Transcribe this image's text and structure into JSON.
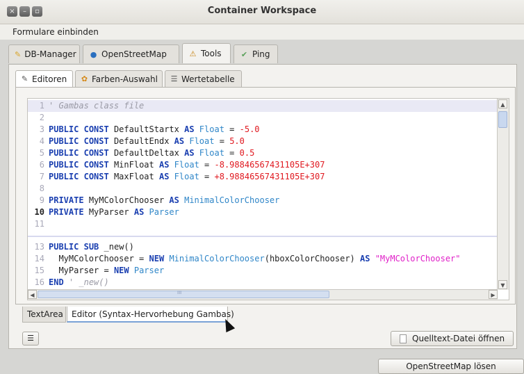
{
  "window": {
    "title": "Container Workspace",
    "controls": {
      "close": "×",
      "minimize": "–",
      "maximize": "▫"
    }
  },
  "menu": {
    "item": "Formulare einbinden"
  },
  "outer_tabs": [
    {
      "label": "DB-Manager",
      "icon": "wand-icon"
    },
    {
      "label": "OpenStreetMap",
      "icon": "globe-icon"
    },
    {
      "label": "Tools",
      "icon": "compass-icon"
    },
    {
      "label": "Ping",
      "icon": "check-icon"
    }
  ],
  "inner_tabs": [
    {
      "label": "Editoren",
      "icon": "edit-icon"
    },
    {
      "label": "Farben-Auswahl",
      "icon": "palette-icon"
    },
    {
      "label": "Wertetabelle",
      "icon": "list-icon"
    }
  ],
  "editor": {
    "line_numbers": [
      "1",
      "2",
      "3",
      "4",
      "5",
      "6",
      "7",
      "8",
      "9",
      "10",
      "11",
      "13",
      "14",
      "15",
      "16"
    ],
    "lines": {
      "l1": "' Gambas class file",
      "l3": [
        "PUBLIC",
        "CONST",
        "DefaultStartx",
        "AS",
        "Float",
        "=",
        "-5.0"
      ],
      "l4": [
        "PUBLIC",
        "CONST",
        "DefaultEndx",
        "AS",
        "Float",
        "=",
        "5.0"
      ],
      "l5": [
        "PUBLIC",
        "CONST",
        "DefaultDeltax",
        "AS",
        "Float",
        "=",
        "0.5"
      ],
      "l6": [
        "PUBLIC",
        "CONST",
        "MinFloat",
        "AS",
        "Float",
        "=",
        "-8.98846567431105E+307"
      ],
      "l7": [
        "PUBLIC",
        "CONST",
        "MaxFloat",
        "AS",
        "Float",
        "=",
        "+8.98846567431105E+307"
      ],
      "l9": [
        "PRIVATE",
        "MyMColorChooser",
        "AS",
        "MinimalColorChooser"
      ],
      "l10": [
        "PRIVATE",
        "MyParser",
        "AS",
        "Parser"
      ],
      "l13": [
        "PUBLIC",
        "SUB",
        "_new()"
      ],
      "l14": [
        "MyMColorChooser =",
        "NEW",
        "MinimalColorChooser",
        "(hboxColorChooser)",
        "AS",
        "\"MyMColorChooser\""
      ],
      "l15": [
        "MyParser =",
        "NEW",
        "Parser"
      ],
      "l16": [
        "END",
        "' _new()"
      ]
    },
    "hscroll_mark": "III"
  },
  "bottom_tabs": [
    {
      "label": "TextArea"
    },
    {
      "label": "Editor (Syntax-Hervorhebung Gambas)"
    }
  ],
  "buttons": {
    "list_icon_button": "☰",
    "open_source_file": "Quelltext-Datei öffnen",
    "solve_osm": "OpenStreetMap lösen"
  }
}
